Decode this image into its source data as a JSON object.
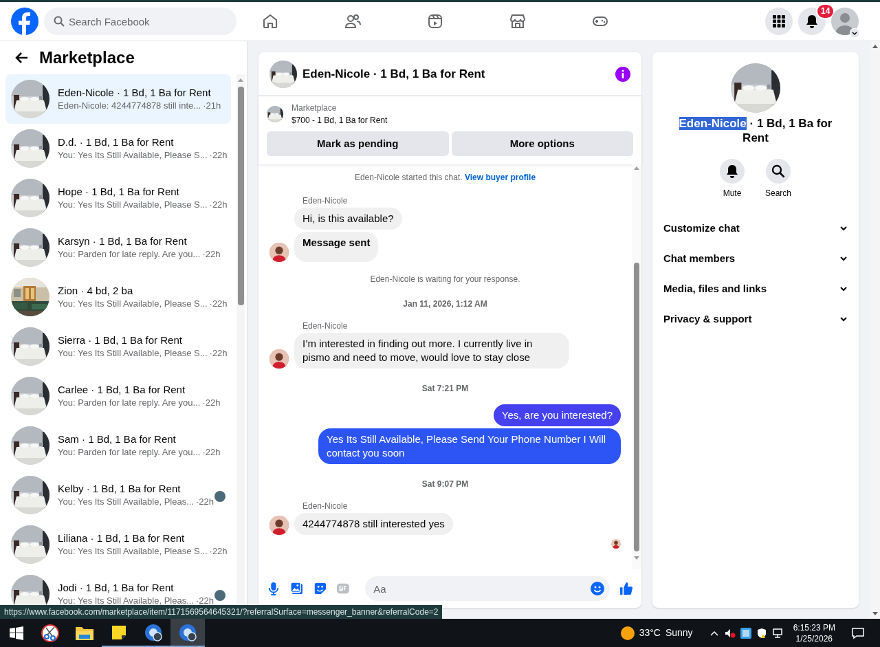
{
  "top_bar": {
    "search_placeholder": "Search Facebook",
    "notification_count": "14"
  },
  "sidebar": {
    "title": "Marketplace",
    "conversations": [
      {
        "name": "Eden-Nicole · 1 Bd, 1 Ba for Rent",
        "preview": "Eden-Nicole: 4244774878 still inte...",
        "time": "·21h",
        "selected": true,
        "seen_avatar": false
      },
      {
        "name": "D.d. · 1 Bd, 1 Ba for Rent",
        "preview": "You: Yes Its Still Available, Please S...",
        "time": "·22h",
        "selected": false,
        "seen_avatar": false
      },
      {
        "name": "Hope · 1 Bd, 1 Ba for Rent",
        "preview": "You: Yes Its Still Available, Please S...",
        "time": "·22h",
        "selected": false,
        "seen_avatar": false
      },
      {
        "name": "Karsyn · 1 Bd, 1 Ba for Rent",
        "preview": "You: Parden for late reply. Are you...",
        "time": "·22h",
        "selected": false,
        "seen_avatar": false
      },
      {
        "name": "Zion · 4 bd, 2 ba",
        "preview": "You: Yes Its Still Available, Please S...",
        "time": "·22h",
        "selected": false,
        "seen_avatar": false
      },
      {
        "name": "Sierra · 1 Bd, 1 Ba for Rent",
        "preview": "You: Yes Its Still Available, Please S...",
        "time": "·22h",
        "selected": false,
        "seen_avatar": false
      },
      {
        "name": "Carlee · 1 Bd, 1 Ba for Rent",
        "preview": "You: Parden for late reply. Are you...",
        "time": "·22h",
        "selected": false,
        "seen_avatar": false
      },
      {
        "name": "Sam · 1 Bd, 1 Ba for Rent",
        "preview": "You: Parden for late reply. Are you...",
        "time": "·22h",
        "selected": false,
        "seen_avatar": false
      },
      {
        "name": "Kelby · 1 Bd, 1 Ba for Rent",
        "preview": "You: Yes Its Still Available, Pleas...",
        "time": "·22h",
        "selected": false,
        "seen_avatar": true
      },
      {
        "name": "Liliana · 1 Bd, 1 Ba for Rent",
        "preview": "You: Yes Its Still Available, Please S...",
        "time": "·22h",
        "selected": false,
        "seen_avatar": false
      },
      {
        "name": "Jodi · 1 Bd, 1 Ba for Rent",
        "preview": "You: Yes Its Still Available, Pleas...",
        "time": "·22h",
        "selected": false,
        "seen_avatar": true
      }
    ]
  },
  "chat": {
    "title": "Eden-Nicole · 1 Bd, 1 Ba for Rent",
    "listing": {
      "label": "Marketplace",
      "summary": "$700 - 1 Bd, 1 Ba for Rent"
    },
    "buttons": [
      "Mark as pending",
      "More options"
    ],
    "messages": [
      {
        "kind": "notice",
        "text": "Eden-Nicole started this chat.",
        "link": "View buyer profile"
      },
      {
        "kind": "sender",
        "text": "Eden-Nicole"
      },
      {
        "kind": "incoming",
        "text": "Hi, is this available?",
        "bold": false,
        "avatar": false
      },
      {
        "kind": "incoming",
        "text": "Message sent",
        "bold": true,
        "avatar": true
      },
      {
        "kind": "status",
        "text": "Eden-Nicole is waiting for your response."
      },
      {
        "kind": "time",
        "text": "Jan 11, 2026, 1:12 AM"
      },
      {
        "kind": "sender",
        "text": "Eden-Nicole"
      },
      {
        "kind": "incoming",
        "text": "I’m interested in finding out more. I currently live in pismo and need to move, would love to stay close",
        "bold": false,
        "avatar": true
      },
      {
        "kind": "time",
        "text": "Sat 7:21 PM"
      },
      {
        "kind": "outgoing",
        "text": "Yes, are you interested?",
        "color": "#4541f0"
      },
      {
        "kind": "outgoing",
        "text": "Yes Its Still Available, Please Send Your Phone Number I Will contact you soon",
        "color": "#2d55f6"
      },
      {
        "kind": "time",
        "text": "Sat 9:07 PM"
      },
      {
        "kind": "sender",
        "text": "Eden-Nicole"
      },
      {
        "kind": "incoming",
        "text": "4244774878 still interested yes",
        "bold": false,
        "avatar": true
      },
      {
        "kind": "read_receipt"
      }
    ],
    "composer": {
      "placeholder": "Aa"
    }
  },
  "details": {
    "title_highlighted": "Eden-Nicole",
    "title_rest": " · 1 Bd, 1 Ba for Rent",
    "actions": [
      {
        "label": "Mute",
        "kind": "bell"
      },
      {
        "label": "Search",
        "kind": "search"
      }
    ],
    "sections": [
      "Customize chat",
      "Chat members",
      "Media, files and links",
      "Privacy & support"
    ]
  },
  "status_url": "https://www.facebook.com/marketplace/item/1171569564645321/?referralSurface=messenger_banner&referralCode=2",
  "taskbar": {
    "temperature": "33°C",
    "weather": "Sunny",
    "time": "6:15:23 PM",
    "date": "1/25/2026"
  }
}
